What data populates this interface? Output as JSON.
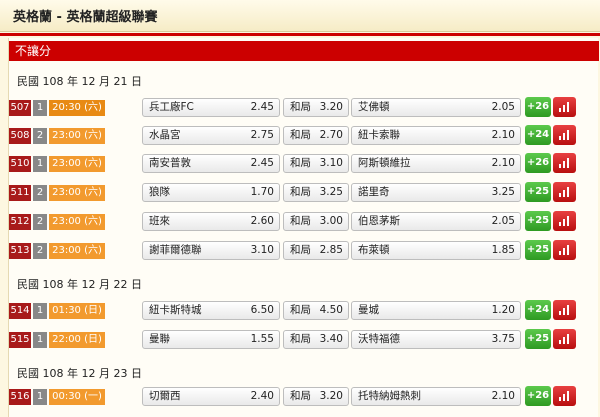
{
  "header": {
    "title": "英格蘭 - 英格蘭超級聯賽"
  },
  "section": {
    "label": "不讓分"
  },
  "dates": [
    "民國 108 年 12 月 21 日",
    "民國 108 年 12 月 22 日",
    "民國 108 年 12 月 23 日"
  ],
  "matches": [
    {
      "code": "507",
      "line": "1",
      "time": "20:30 (六)",
      "home": "兵工廠FC",
      "home_odds": "2.45",
      "draw": "和局",
      "draw_odds": "3.20",
      "away": "艾佛頓",
      "away_odds": "2.05",
      "more": "+26"
    },
    {
      "code": "508",
      "line": "2",
      "time": "23:00 (六)",
      "home": "水晶宮",
      "home_odds": "2.75",
      "draw": "和局",
      "draw_odds": "2.70",
      "away": "紐卡索聯",
      "away_odds": "2.10",
      "more": "+24"
    },
    {
      "code": "510",
      "line": "1",
      "time": "23:00 (六)",
      "home": "南安普敦",
      "home_odds": "2.45",
      "draw": "和局",
      "draw_odds": "3.10",
      "away": "阿斯頓維拉",
      "away_odds": "2.10",
      "more": "+26"
    },
    {
      "code": "511",
      "line": "2",
      "time": "23:00 (六)",
      "home": "狼隊",
      "home_odds": "1.70",
      "draw": "和局",
      "draw_odds": "3.25",
      "away": "諾里奇",
      "away_odds": "3.25",
      "more": "+25"
    },
    {
      "code": "512",
      "line": "2",
      "time": "23:00 (六)",
      "home": "班來",
      "home_odds": "2.60",
      "draw": "和局",
      "draw_odds": "3.00",
      "away": "伯恩茅斯",
      "away_odds": "2.05",
      "more": "+25"
    },
    {
      "code": "513",
      "line": "2",
      "time": "23:00 (六)",
      "home": "謝菲爾德聯",
      "home_odds": "3.10",
      "draw": "和局",
      "draw_odds": "2.85",
      "away": "布萊頓",
      "away_odds": "1.85",
      "more": "+25"
    },
    {
      "code": "514",
      "line": "1",
      "time": "01:30 (日)",
      "home": "紐卡斯特城",
      "home_odds": "6.50",
      "draw": "和局",
      "draw_odds": "4.50",
      "away": "曼城",
      "away_odds": "1.20",
      "more": "+24"
    },
    {
      "code": "515",
      "line": "1",
      "time": "22:00 (日)",
      "home": "曼聯",
      "home_odds": "1.55",
      "draw": "和局",
      "draw_odds": "3.40",
      "away": "沃特福德",
      "away_odds": "3.75",
      "more": "+25"
    },
    {
      "code": "516",
      "line": "1",
      "time": "00:30 (一)",
      "home": "切爾西",
      "home_odds": "2.40",
      "draw": "和局",
      "draw_odds": "3.20",
      "away": "托特納姆熱刺",
      "away_odds": "2.10",
      "more": "+26"
    }
  ],
  "icons": {
    "stats": "bar-chart-icon"
  },
  "colors": {
    "accent_red": "#cc0000",
    "code_bg": "#a81a1a",
    "time_bg": "#f29a2e",
    "more_green": "#3aa52c"
  }
}
